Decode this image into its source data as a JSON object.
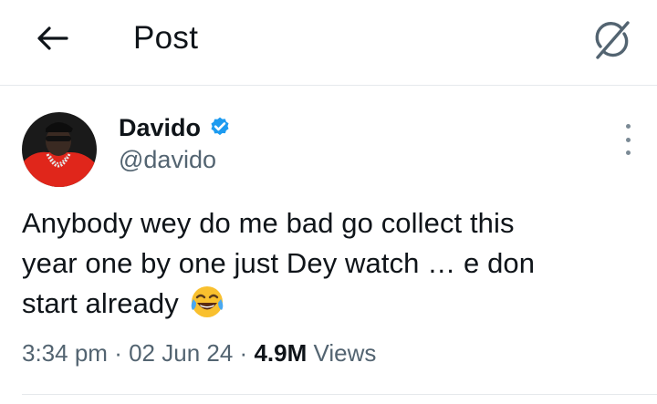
{
  "header": {
    "title": "Post",
    "back_icon": "arrow-left-icon",
    "grok_icon": "grok-icon"
  },
  "author": {
    "name": "Davido",
    "handle": "@davido",
    "verified_icon": "verified-badge-icon",
    "verified_color": "#1d9bf0",
    "more_icon": "more-vertical-icon"
  },
  "post": {
    "text_lines": [
      "Anybody wey do me bad go collect this",
      "year one by one just Dey watch … e don",
      "start already"
    ],
    "emoji": "😂"
  },
  "meta": {
    "time": "3:34 pm",
    "date": "02 Jun 24",
    "separator": "·",
    "views_count": "4.9M",
    "views_label": "Views"
  },
  "colors": {
    "text": "#0f1419",
    "secondary": "#536471",
    "border": "#e6e9ec",
    "avatar_jacket": "#e0261b"
  }
}
